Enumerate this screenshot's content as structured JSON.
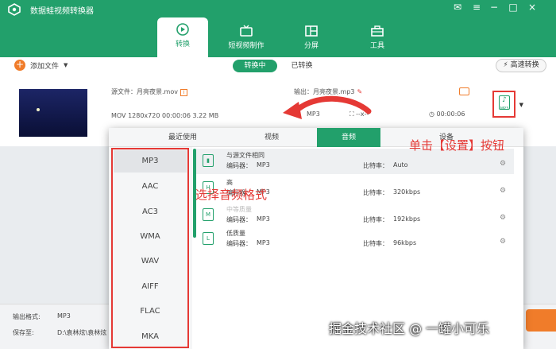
{
  "app": {
    "title": "数据蛙视频转换器",
    "logo_icon": "app-logo-icon"
  },
  "nav": {
    "tabs": [
      {
        "label": "转换",
        "icon": "convert-icon",
        "active": true
      },
      {
        "label": "短视频制作",
        "icon": "tv-icon"
      },
      {
        "label": "分屏",
        "icon": "split-icon"
      },
      {
        "label": "工具",
        "icon": "toolbox-icon"
      }
    ]
  },
  "toolbar": {
    "add_file": "添加文件",
    "converting": "转换中",
    "converted": "已转换",
    "high_speed": "高速转换"
  },
  "file": {
    "source_label": "源文件：",
    "source_name": "月亮夜景.mov",
    "output_label": "输出：",
    "output_name": "月亮夜景.mp3",
    "meta": "MOV   1280x720   00:00:06   3.22 MB",
    "out_format": "MP3",
    "out_size": "--x--",
    "out_duration": "00:00:06"
  },
  "popup": {
    "tabs": [
      "最近使用",
      "视频",
      "音频",
      "设备"
    ],
    "active_tab": "音频",
    "formats": [
      "MP3",
      "AAC",
      "AC3",
      "WMA",
      "WAV",
      "AIFF",
      "FLAC",
      "MKA"
    ],
    "selected_format": "MP3",
    "presets": [
      {
        "name": "与源文件相同",
        "encoder_label": "编码器：",
        "encoder": "MP3",
        "bitrate_label": "比特率：",
        "bitrate": "Auto"
      },
      {
        "name": "高",
        "encoder_label": "编码器：",
        "encoder": "MP3",
        "bitrate_label": "比特率：",
        "bitrate": "320kbps"
      },
      {
        "name": "中等质量",
        "encoder_label": "编码器：",
        "encoder": "MP3",
        "bitrate_label": "比特率：",
        "bitrate": "192kbps"
      },
      {
        "name": "低质量",
        "encoder_label": "编码器：",
        "encoder": "MP3",
        "bitrate_label": "比特率：",
        "bitrate": "96kbps"
      }
    ]
  },
  "bottom": {
    "output_format_label": "输出格式:",
    "output_format_value": "MP3",
    "save_to_label": "保存至:",
    "save_to_value": "D:\\袁林炫\\袁林炫"
  },
  "annotations": {
    "settings_hint": "单击【设置】按钮",
    "format_hint": "选择音频格式"
  },
  "watermark": "掘金技术社区 @ 一罐小可乐",
  "colors": {
    "brand": "#22a06b",
    "accent": "#f07c2a",
    "annotation": "#e53935"
  }
}
